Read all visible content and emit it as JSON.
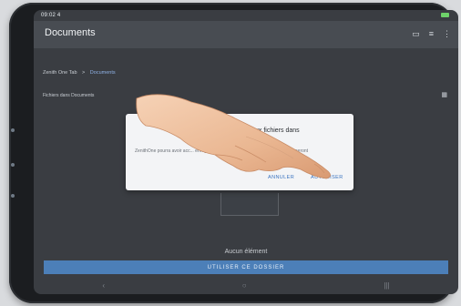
{
  "status": {
    "time": "09:02 4"
  },
  "appbar": {
    "title": "Documents",
    "icons": [
      "new-folder-icon",
      "sort-icon",
      "more-vert-icon"
    ]
  },
  "breadcrumb": {
    "root": "Zenith One Tab",
    "separator": ">",
    "current": "Documents"
  },
  "section": {
    "label": "Fichiers dans Documents"
  },
  "dialog": {
    "title": "...r aux fichiers dans",
    "title_line2": "...",
    "body": "ZenithOne pourra avoir acc... enregistrés dans Documents.",
    "body_right": "...seront",
    "cancel_label": "ANNULER",
    "allow_label": "AUTORISER"
  },
  "empty_state": {
    "text": "Aucun élément"
  },
  "use_folder_button": {
    "label": "UTILISER CE DOSSIER"
  },
  "navbar": {
    "back": "‹",
    "home": "○",
    "recents": "|||"
  },
  "colors": {
    "accent": "#4c7fb8",
    "appbar": "#484c52",
    "screen": "#3a3d42",
    "dialog": "#f3f4f6"
  }
}
